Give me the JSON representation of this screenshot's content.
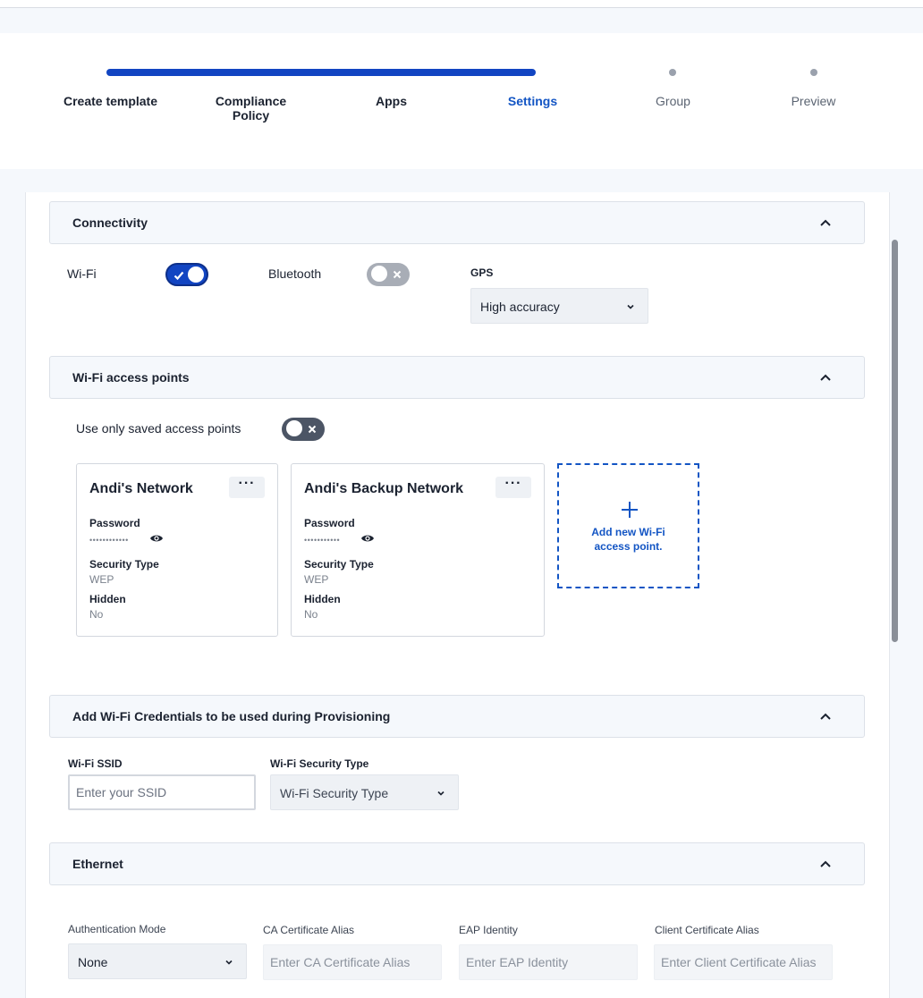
{
  "stepper": {
    "steps": [
      {
        "label": "Create template",
        "state": "done"
      },
      {
        "label": "Compliance\nPolicy",
        "state": "done"
      },
      {
        "label": "Apps",
        "state": "done"
      },
      {
        "label": "Settings",
        "state": "active"
      },
      {
        "label": "Group",
        "state": "pending"
      },
      {
        "label": "Preview",
        "state": "pending"
      }
    ]
  },
  "connectivity": {
    "title": "Connectivity",
    "wifi_label": "Wi-Fi",
    "wifi_enabled": true,
    "bluetooth_label": "Bluetooth",
    "bluetooth_enabled": false,
    "gps_label": "GPS",
    "gps_value": "High accuracy"
  },
  "access_points": {
    "title": "Wi-Fi access points",
    "saved_only_label": "Use only saved access points",
    "saved_only_enabled": false,
    "networks": [
      {
        "name": "Andi's Network",
        "password_label": "Password",
        "password_mask": "••••••••••••",
        "security_label": "Security Type",
        "security_value": "WEP",
        "hidden_label": "Hidden",
        "hidden_value": "No"
      },
      {
        "name": "Andi's Backup Network",
        "password_label": "Password",
        "password_mask": "•••••••••••",
        "security_label": "Security Type",
        "security_value": "WEP",
        "hidden_label": "Hidden",
        "hidden_value": "No"
      }
    ],
    "more_label": "···",
    "add_label": "Add new Wi-Fi access point."
  },
  "provisioning": {
    "title": "Add Wi-Fi Credentials to be used during Provisioning",
    "ssid_label": "Wi-Fi SSID",
    "ssid_placeholder": "Enter your SSID",
    "security_label": "Wi-Fi Security Type",
    "security_value": "Wi-Fi Security Type"
  },
  "ethernet": {
    "title": "Ethernet",
    "auth_label": "Authentication Mode",
    "auth_value": "None",
    "ca_label": "CA Certificate Alias",
    "ca_placeholder": "Enter CA Certificate Alias",
    "eap_label": "EAP Identity",
    "eap_placeholder": "Enter EAP Identity",
    "client_label": "Client Certificate Alias",
    "client_placeholder": "Enter Client Certificate Alias"
  },
  "colors": {
    "accent": "#1245c2",
    "link": "#1355c4",
    "toggle_off_dark": "#4c5565",
    "toggle_off_light": "#a8adb6"
  }
}
